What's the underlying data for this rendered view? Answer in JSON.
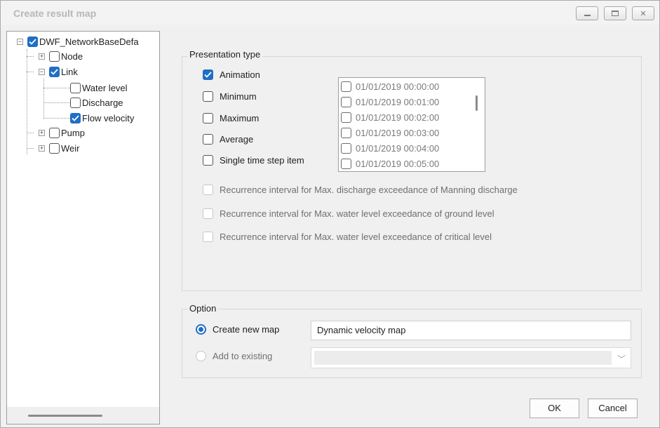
{
  "window": {
    "title": "Create result map"
  },
  "tree": {
    "root": {
      "label": "DWF_NetworkBaseDefa",
      "checked": true,
      "expanded": true
    },
    "items": [
      {
        "label": "Node",
        "checked": false
      },
      {
        "label": "Link",
        "checked": true
      },
      {
        "label": "Water level",
        "checked": false
      },
      {
        "label": "Discharge",
        "checked": false
      },
      {
        "label": "Flow velocity",
        "checked": true
      },
      {
        "label": "Pump",
        "checked": false
      },
      {
        "label": "Weir",
        "checked": false
      }
    ]
  },
  "presentation": {
    "group_title": "Presentation type",
    "options": [
      {
        "label": "Animation",
        "checked": true
      },
      {
        "label": "Minimum",
        "checked": false
      },
      {
        "label": "Maximum",
        "checked": false
      },
      {
        "label": "Average",
        "checked": false
      },
      {
        "label": "Single time step item",
        "checked": false
      }
    ],
    "time_steps": [
      "01/01/2019 00:00:00",
      "01/01/2019 00:01:00",
      "01/01/2019 00:02:00",
      "01/01/2019 00:03:00",
      "01/01/2019 00:04:00",
      "01/01/2019 00:05:00"
    ],
    "recurrence_options": [
      "Recurrence interval for Max. discharge exceedance of Manning discharge",
      "Recurrence interval for Max. water level exceedance of ground level",
      "Recurrence interval for Max. water level exceedance of critical level"
    ]
  },
  "option": {
    "group_title": "Option",
    "create_new_label": "Create new map",
    "add_existing_label": "Add to existing",
    "new_map_name": "Dynamic velocity map",
    "selected": "create_new"
  },
  "buttons": {
    "ok": "OK",
    "cancel": "Cancel"
  },
  "colors": {
    "accent": "#1f6fc5"
  }
}
